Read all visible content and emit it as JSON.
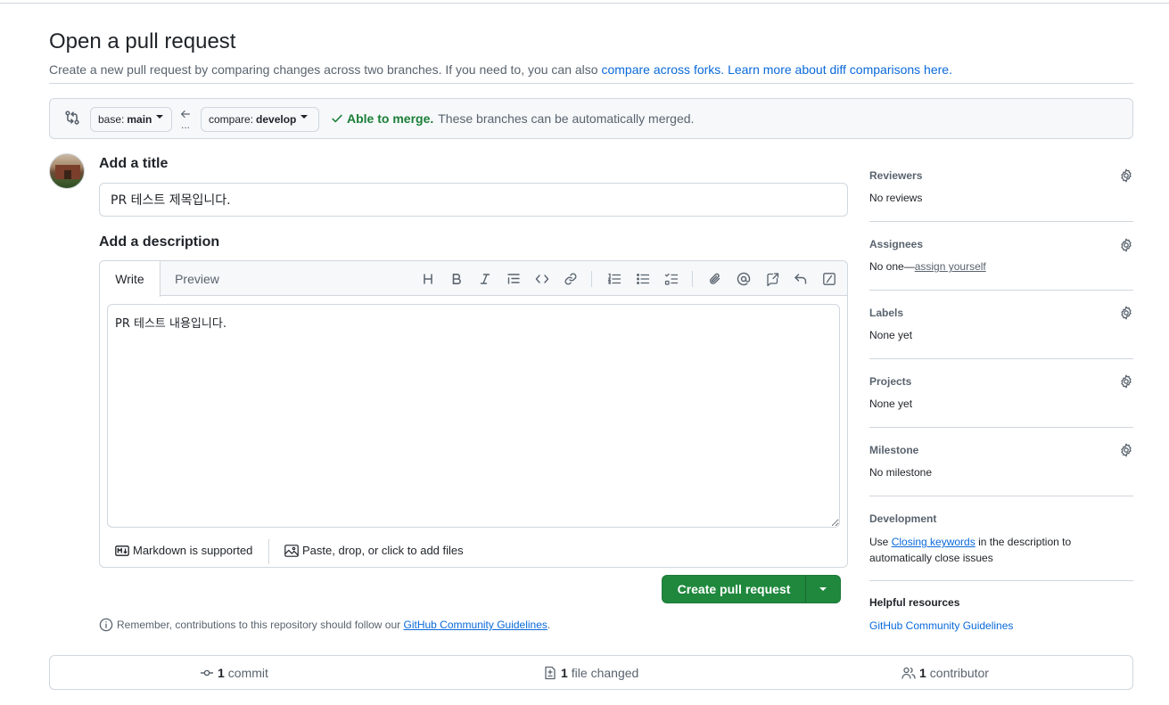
{
  "header": {
    "title": "Open a pull request",
    "subtitle_text": "Create a new pull request by comparing changes across two branches. If you need to, you can also",
    "fork_link": "compare across forks.",
    "learn_link": "Learn more about diff comparisons here."
  },
  "compare": {
    "base_prefix": "base:",
    "base_branch": "main",
    "compare_prefix": "compare:",
    "compare_branch": "develop",
    "dots": "...",
    "merge_ok": "Able to merge.",
    "merge_msg": "These branches can be automatically merged."
  },
  "form": {
    "title_label": "Add a title",
    "title_value": "PR 테스트 제목입니다.",
    "desc_label": "Add a description",
    "write_tab": "Write",
    "preview_tab": "Preview",
    "body_value": "PR 테스트 내용입니다.",
    "markdown_note": "Markdown is supported",
    "paste_note": "Paste, drop, or click to add files",
    "submit_label": "Create pull request",
    "remember_text": "Remember, contributions to this repository should follow our",
    "remember_link": "GitHub Community Guidelines",
    "remember_end": "."
  },
  "toolbar": {
    "icons": [
      "heading-icon",
      "bold-icon",
      "italic-icon",
      "quote-icon",
      "code-icon",
      "link-icon",
      "ordered-list-icon",
      "unordered-list-icon",
      "task-list-icon",
      "attach-icon",
      "mention-icon",
      "reference-icon",
      "undo-icon",
      "slash-command-icon"
    ]
  },
  "sidebar": {
    "reviewers_title": "Reviewers",
    "reviewers_value": "No reviews",
    "assignees_title": "Assignees",
    "assignees_prefix": "No one—",
    "assignees_link": "assign yourself",
    "labels_title": "Labels",
    "labels_value": "None yet",
    "projects_title": "Projects",
    "projects_value": "None yet",
    "milestone_title": "Milestone",
    "milestone_value": "No milestone",
    "development_title": "Development",
    "development_prefix": "Use",
    "development_link": "Closing keywords",
    "development_suffix": "in the description to automatically close issues",
    "help_title": "Helpful resources",
    "help_link": "GitHub Community Guidelines"
  },
  "summary": {
    "commits_count": "1",
    "commits_label": "commit",
    "files_count": "1",
    "files_label": "file changed",
    "contributors_count": "1",
    "contributors_label": "contributor"
  },
  "colors": {
    "accent": "#0969da",
    "success": "#1a7f37",
    "button": "#1f883d",
    "border": "#d0d7de"
  }
}
